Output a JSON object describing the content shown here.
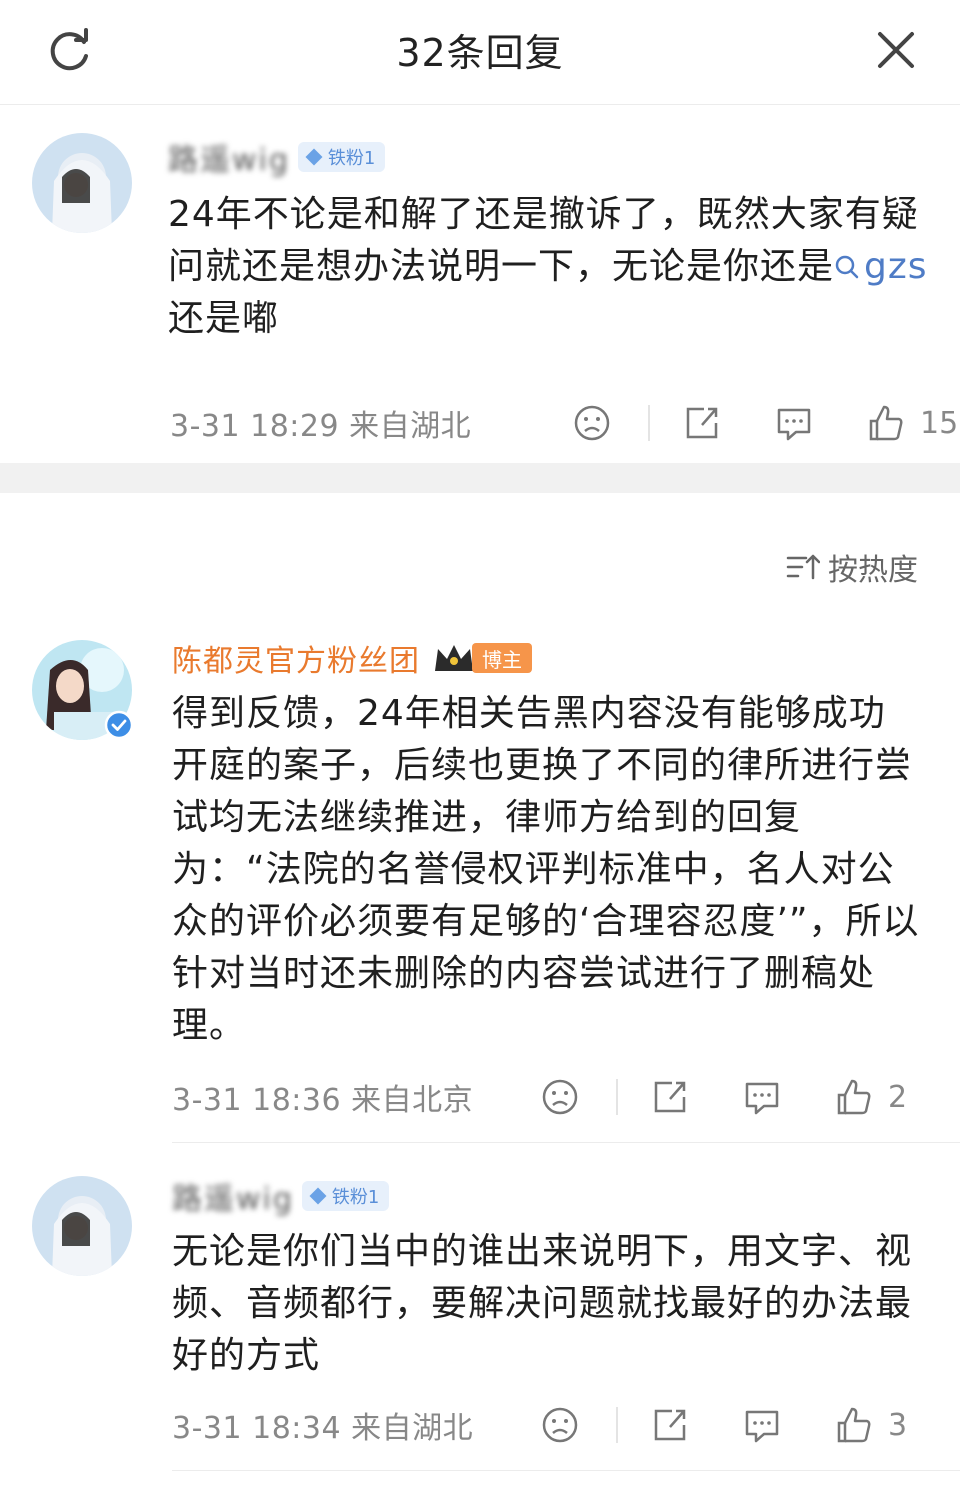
{
  "header": {
    "title": "32条回复",
    "refresh_icon": "refresh-icon",
    "close_icon": "close-icon"
  },
  "root_comment": {
    "username": "路遥wig",
    "fan_badge": "铁粉1",
    "text_before_topic": "24年不论是和解了还是撤诉了，既然大家有疑问就还是想办法说明一下，无论是你还是",
    "topic": "gzs",
    "text_after_topic": " 还是嘟",
    "time": "3-31 18:29",
    "location": "来自湖北",
    "likes": "15"
  },
  "sort": {
    "label": "按热度",
    "icon": "sort-icon"
  },
  "replies": [
    {
      "username": "陈都灵官方粉丝团",
      "role_badge": "博主",
      "text": "得到反馈，24年相关告黑内容没有能够成功开庭的案子，后续也更换了不同的律所进行尝试均无法继续推进，律师方给到的回复为：“法院的名誉侵权评判标准中，名人对公众的评价必须要有足够的‘合理容忍度’”，所以针对当时还未删除的内容尝试进行了删稿处理。",
      "time": "3-31 18:36",
      "location": "来自北京",
      "likes": "2"
    },
    {
      "username": "路遥wig",
      "fan_badge": "铁粉1",
      "text": "无论是你们当中的谁出来说明下，用文字、视频、音频都行，要解决问题就找最好的办法最好的方式",
      "time": "3-31 18:34",
      "location": "来自湖北",
      "likes": "3"
    }
  ],
  "colors": {
    "link": "#4f7cc6",
    "official_name": "#e97a2e",
    "host_badge": "#f6954a",
    "fan_badge_bg": "#e7f0fb",
    "meta": "#888888"
  }
}
